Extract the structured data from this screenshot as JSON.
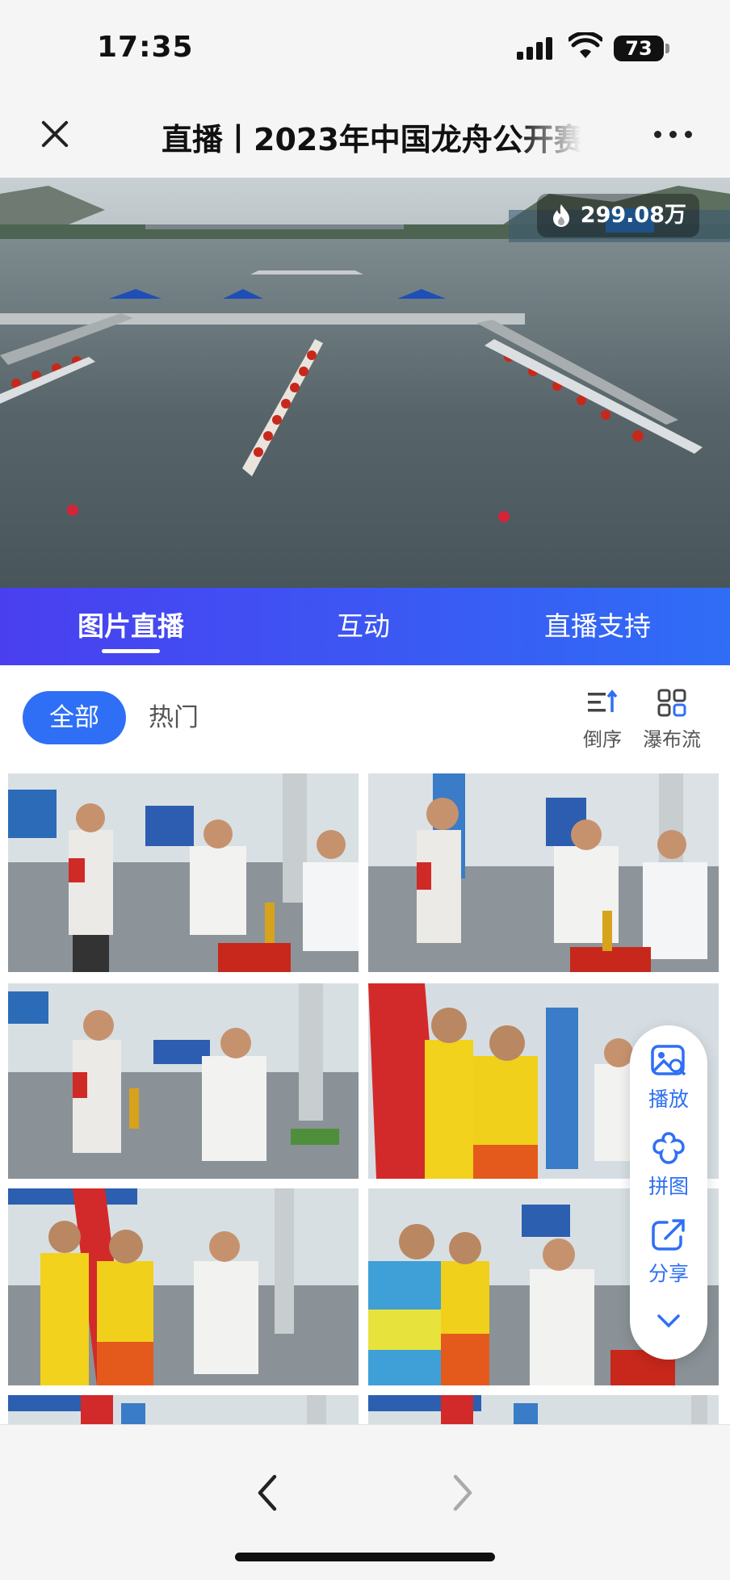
{
  "status_bar": {
    "time": "17:35",
    "battery": "73"
  },
  "nav": {
    "title": "直播丨2023年中国龙舟公开赛"
  },
  "hero": {
    "heat_count": "299.08万",
    "icon": "fire-icon"
  },
  "tabs": [
    {
      "label": "图片直播",
      "active": true
    },
    {
      "label": "互动",
      "active": false
    },
    {
      "label": "直播支持",
      "active": false
    }
  ],
  "filters": {
    "all_label": "全部",
    "hot_label": "热门"
  },
  "tools": {
    "sort_label": "倒序",
    "waterfall_label": "瀑布流"
  },
  "fab": {
    "play_label": "播放",
    "puzzle_label": "拼图",
    "share_label": "分享"
  },
  "colors": {
    "accent": "#2e6ff5",
    "tab_gradient_start": "#4a3ff0",
    "tab_gradient_end": "#2f6df6"
  }
}
